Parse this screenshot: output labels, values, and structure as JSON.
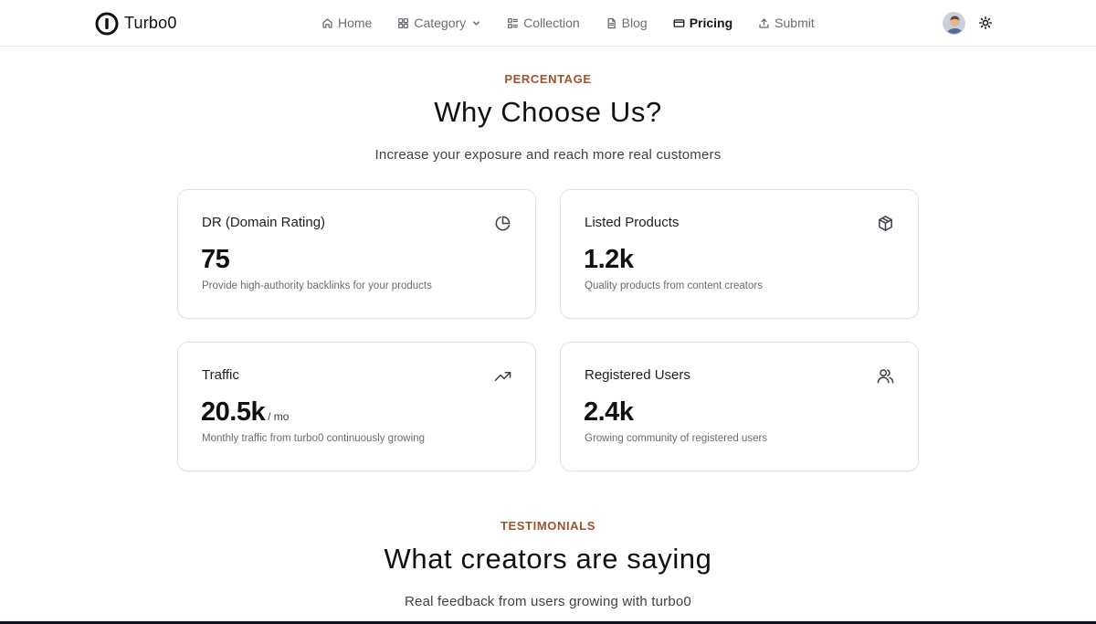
{
  "brand": {
    "name": "Turbo0"
  },
  "nav": {
    "items": [
      {
        "label": "Home",
        "icon": "home-icon"
      },
      {
        "label": "Category",
        "icon": "grid-icon"
      },
      {
        "label": "Collection",
        "icon": "collection-icon"
      },
      {
        "label": "Blog",
        "icon": "document-icon"
      },
      {
        "label": "Pricing",
        "icon": "credit-card-icon",
        "active": true
      },
      {
        "label": "Submit",
        "icon": "upload-icon"
      }
    ]
  },
  "stats_section": {
    "eyebrow": "PERCENTAGE",
    "title": "Why Choose Us?",
    "subtitle": "Increase your exposure and reach more real customers",
    "cards": [
      {
        "title": "DR (Domain Rating)",
        "value": "75",
        "unit": "",
        "description": "Provide high-authority backlinks for your products",
        "icon": "pie-chart-icon"
      },
      {
        "title": "Listed Products",
        "value": "1.2k",
        "unit": "",
        "description": "Quality products from content creators",
        "icon": "package-icon"
      },
      {
        "title": "Traffic",
        "value": "20.5k",
        "unit": "/ mo",
        "description": "Monthly traffic from turbo0 continuously growing",
        "icon": "trending-up-icon"
      },
      {
        "title": "Registered Users",
        "value": "2.4k",
        "unit": "",
        "description": "Growing community of registered users",
        "icon": "users-icon"
      }
    ]
  },
  "testimonials_section": {
    "eyebrow": "TESTIMONIALS",
    "title": "What creators are saying",
    "subtitle": "Real feedback from users growing with turbo0"
  },
  "colors": {
    "accent": "#a0512d",
    "text": "#111111",
    "muted": "#6b6b74",
    "border": "#e3e3e7"
  }
}
